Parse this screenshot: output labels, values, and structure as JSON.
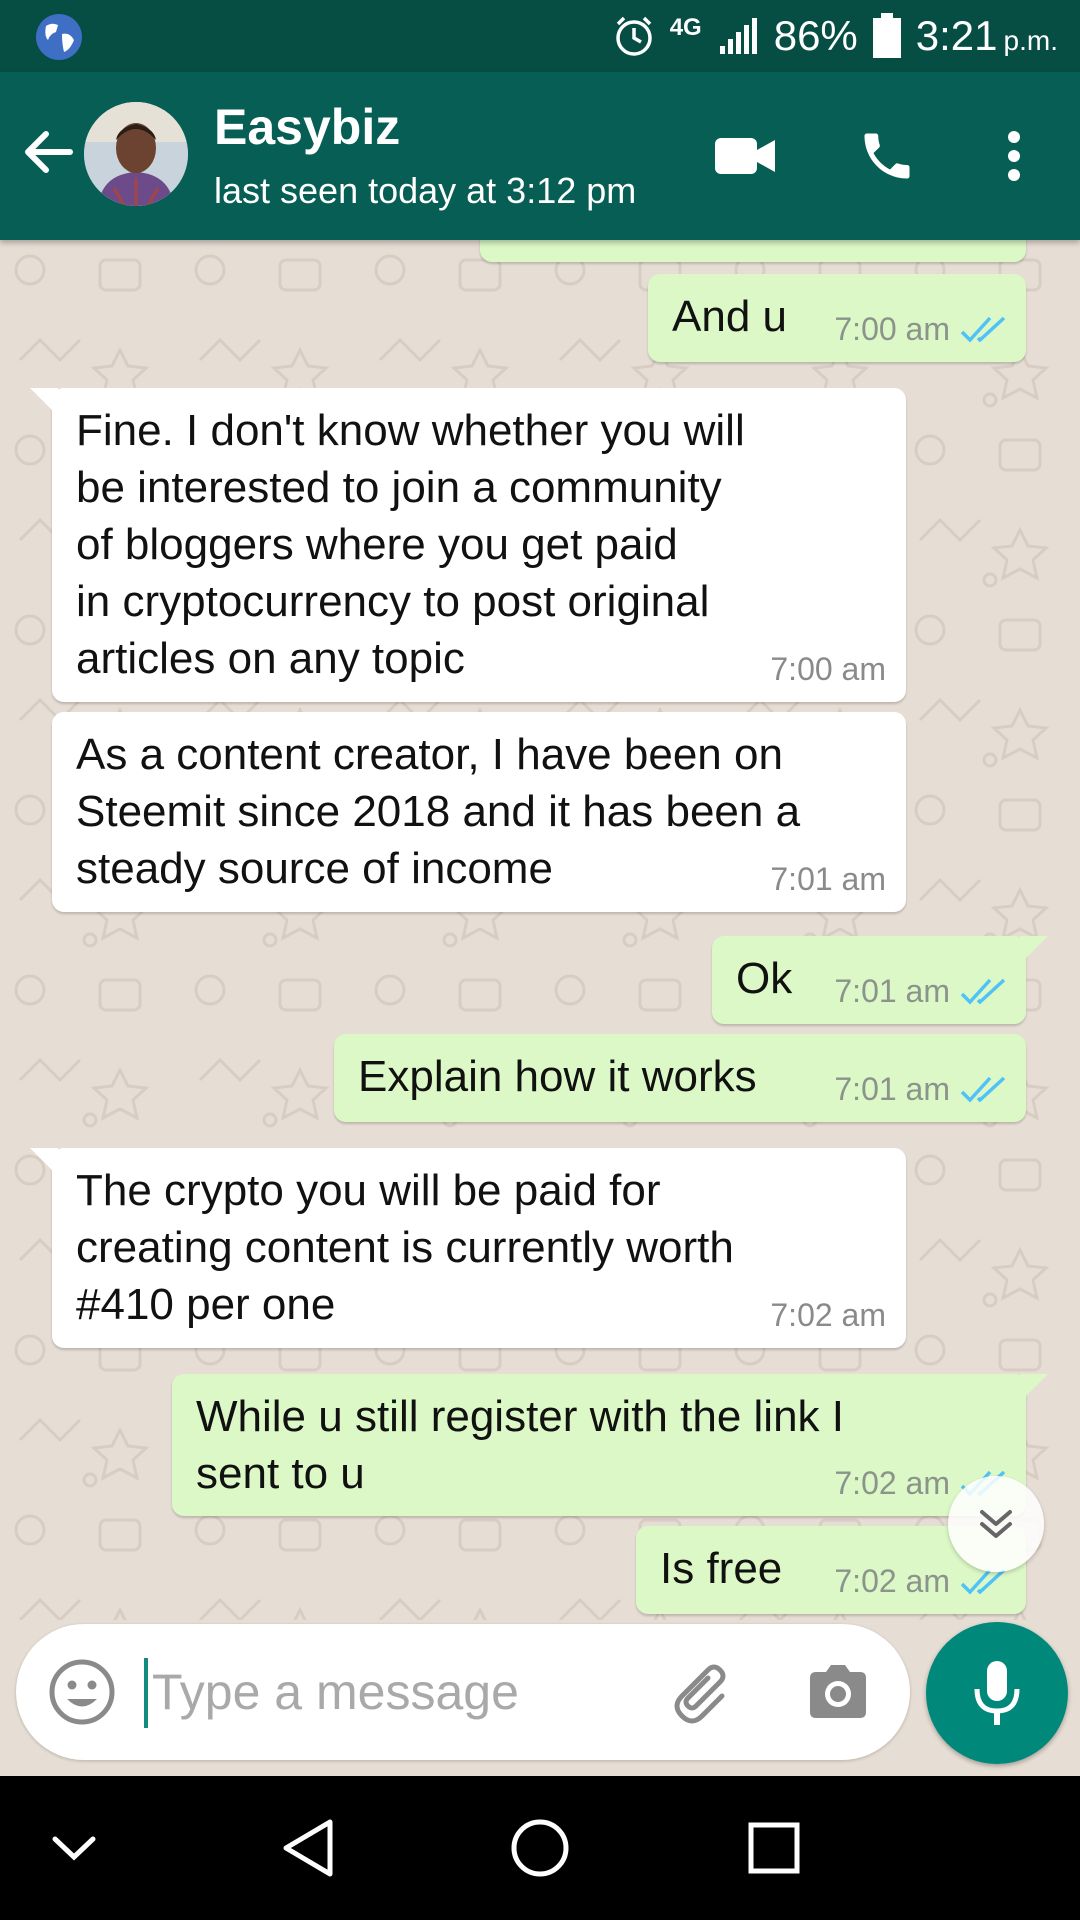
{
  "status_bar": {
    "network": "4G",
    "battery": "86%",
    "time": "3:21",
    "ampm": "p.m."
  },
  "header": {
    "contact_name": "Easybiz",
    "last_seen": "last seen today at 3:12 pm"
  },
  "messages": [
    {
      "direction": "out",
      "text": "And u",
      "time": "7:00 am",
      "ticks": "read"
    },
    {
      "direction": "in",
      "text": "Fine. I don't know whether you will\nbe interested to join a community\nof bloggers where you get paid\nin cryptocurrency to post original\narticles on any topic",
      "time": "7:00 am"
    },
    {
      "direction": "in",
      "text": "As a content creator, I have been on\nSteemit since 2018 and it has been a\nsteady source of income",
      "time": "7:01 am"
    },
    {
      "direction": "out",
      "text": "Ok",
      "time": "7:01 am",
      "ticks": "read"
    },
    {
      "direction": "out",
      "text": "Explain how it works",
      "time": "7:01 am",
      "ticks": "read"
    },
    {
      "direction": "in",
      "text": "The crypto you will be paid for\ncreating content is currently worth\n#410 per one",
      "time": "7:02 am"
    },
    {
      "direction": "out",
      "text": "While u still register with the link I\nsent to u",
      "time": "7:02 am",
      "ticks": "read"
    },
    {
      "direction": "out",
      "text": "Is free",
      "time": "7:02 am",
      "ticks": "read"
    }
  ],
  "input": {
    "placeholder": "Type a message"
  },
  "colors": {
    "header": "#075e54",
    "status_bar": "#064e44",
    "outgoing_bubble": "#dcf8c6",
    "incoming_bubble": "#ffffff",
    "read_ticks": "#4fc3f7",
    "mic_button": "#00897b"
  },
  "icons": {
    "status_left": "globe-icon",
    "status_right": [
      "alarm-icon",
      "signal-icon",
      "battery-icon"
    ],
    "header": [
      "back-arrow-icon",
      "video-call-icon",
      "phone-icon",
      "more-vert-icon"
    ],
    "input": [
      "emoji-icon",
      "attach-icon",
      "camera-icon",
      "mic-icon"
    ],
    "nav": [
      "chevron-down-icon",
      "back-triangle-icon",
      "home-circle-icon",
      "recents-square-icon"
    ]
  }
}
